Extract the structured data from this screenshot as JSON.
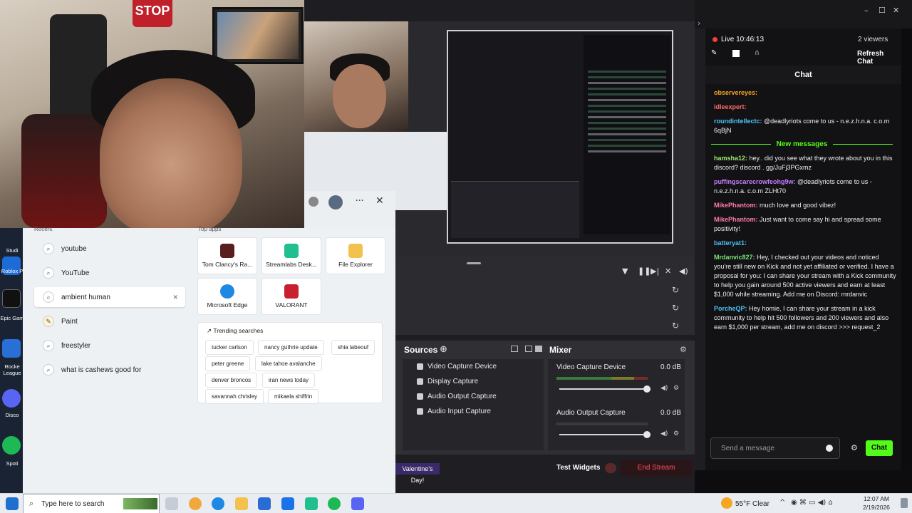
{
  "webcam": {
    "stop_sign": "STOP"
  },
  "obs": {
    "sources_title": "Sources",
    "mixer_title": "Mixer",
    "sources": [
      "Video Capture Device",
      "Display Capture",
      "Audio Output Capture",
      "Audio Input Capture"
    ],
    "mixer_items": [
      {
        "name": "Video Capture Device",
        "level": "0.0 dB"
      },
      {
        "name": "Audio Output Capture",
        "level": "0.0 dB"
      }
    ],
    "ticker": "Valentine's Day!",
    "test_widgets": "Test Widgets",
    "end_stream": "End Stream"
  },
  "chat": {
    "live_label": "Live 10:46:13",
    "viewers": "2 viewers",
    "refresh": "Refresh Chat",
    "title": "Chat",
    "new_messages": "New messages",
    "messages": [
      {
        "user": "observereyes:",
        "color": "#f5a623",
        "text": ""
      },
      {
        "user": "idleexpert:",
        "color": "#ff6b6b",
        "text": ""
      },
      {
        "user": "roundintellectc:",
        "color": "#4fc3f7",
        "text": "@deadlyriots come to us - n.e.z.h.n.a. c.o.m 6qBjN"
      },
      {
        "user": "hamsha12:",
        "color": "#9fe870",
        "text": "hey.. did you see what they wrote about you in this discord? discord . gg/JuFj3PGxmz"
      },
      {
        "user": "puffingscarecrowfeohg9w:",
        "color": "#c77dff",
        "text": "@deadlyriots come to us - n.e.z.h.n.a. c.o.m ZLHt70"
      },
      {
        "user": "MikePhantom:",
        "color": "#ff7aa8",
        "text": "much love and good vibez!"
      },
      {
        "user": "MikePhantom:",
        "color": "#ff7aa8",
        "text": "Just want to come say hi and spread some positivity!"
      },
      {
        "user": "batteryat1:",
        "color": "#4fc3f7",
        "text": ""
      },
      {
        "user": "Mrdanvic827:",
        "color": "#7be07b",
        "text": "Hey, I checked out your videos and noticed you're still new on Kick and not yet affiliated or verified. I have a proposal for you: I can share your stream with a Kick community to help you gain around 500 active viewers and earn at least $1,000 while streaming. Add me on Discord: mrdanvic"
      },
      {
        "user": "PorcheQP:",
        "color": "#4fc3f7",
        "text": "Hey homie, I can share your stream in a kick community to help hit 500 followers and 200 viewers and also earn $1,000 per stream, add me on discord >>> request_2"
      }
    ],
    "input_placeholder": "Send a message",
    "send_label": "Chat"
  },
  "start_menu": {
    "recent_label": "Recent",
    "top_apps_label": "Top apps",
    "recent": [
      "youtube",
      "YouTube",
      "ambient human",
      "Paint",
      "freestyler",
      "what is cashews good for"
    ],
    "top_apps": [
      {
        "name": "Tom Clancy's Ra...",
        "color": "#5a1d1d"
      },
      {
        "name": "Streamlabs Desk...",
        "color": "#1fbf8f"
      },
      {
        "name": "File Explorer",
        "color": "#f2c14e"
      },
      {
        "name": "Microsoft Edge",
        "color": "#1e88e5"
      },
      {
        "name": "VALORANT",
        "color": "#c8202f"
      }
    ],
    "trending_label": "Trending searches",
    "trending": [
      "tucker carlson",
      "nancy guthrie update",
      "shia labeouf",
      "peter greene",
      "lake tahoe avalanche",
      "denver broncos",
      "iran news today",
      "savannah chrisley",
      "mikaela shiffrin"
    ]
  },
  "desktop_icons": [
    "Studi",
    "Roblox P",
    "Epic Gam",
    "Rocke League",
    "Disco",
    "Spoti"
  ],
  "taskbar": {
    "search_placeholder": "Type here to search",
    "weather": "55°F Clear",
    "time": "12:07 AM",
    "date": "2/19/2026"
  }
}
